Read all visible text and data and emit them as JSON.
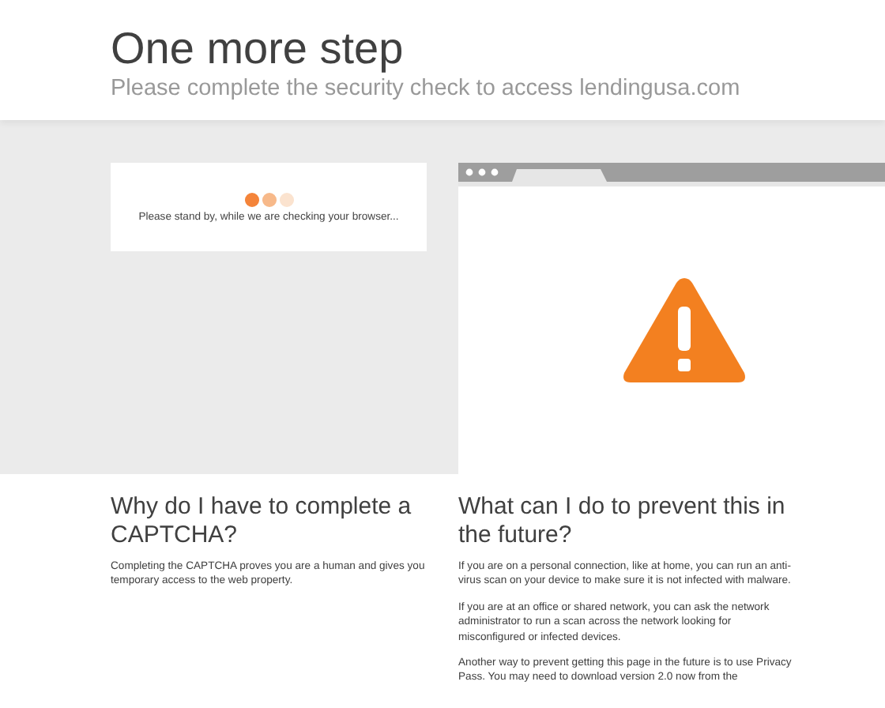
{
  "header": {
    "title": "One more step",
    "subtitle": "Please complete the security check to access lendingusa.com"
  },
  "check_card": {
    "loading_dots": [
      {
        "color": "#f4843a"
      },
      {
        "color": "#f7b98a"
      },
      {
        "color": "#fbe3cf"
      }
    ],
    "message": "Please stand by, while we are checking your browser..."
  },
  "sections": [
    {
      "heading": "Why do I have to complete a CAPTCHA?",
      "paragraphs": [
        "Completing the CAPTCHA proves you are a human and gives you temporary access to the web property."
      ]
    },
    {
      "heading": "What can I do to prevent this in the future?",
      "paragraphs": [
        "If you are on a personal connection, like at home, you can run an anti-virus scan on your device to make sure it is not infected with malware.",
        "If you are at an office or shared network, you can ask the network administrator to run a scan across the network looking for misconfigured or infected devices.",
        "Another way to prevent getting this page in the future is to use Privacy Pass. You may need to download version 2.0 now from the"
      ]
    }
  ]
}
